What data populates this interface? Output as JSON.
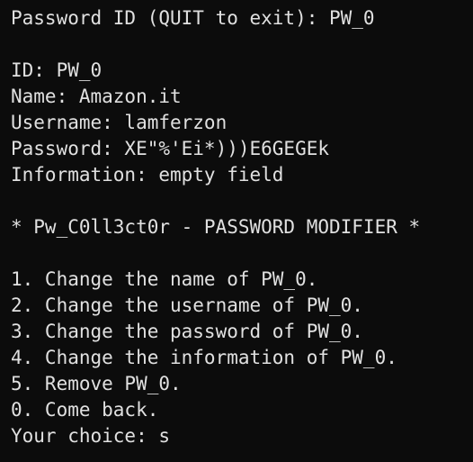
{
  "terminal": {
    "prompt_line": "Password ID (QUIT to exit): PW_0",
    "record": {
      "id_line": "ID: PW_0",
      "name_line": "Name: Amazon.it",
      "username_line": "Username: lamferzon",
      "password_line": "Password: XE\"%'Ei*)))E6GEGEk",
      "information_line": "Information: empty field"
    },
    "menu_title": "* Pw_C0ll3ct0r - PASSWORD MODIFIER *",
    "menu_items": [
      "1. Change the name of PW_0.",
      "2. Change the username of PW_0.",
      "3. Change the password of PW_0.",
      "4. Change the information of PW_0.",
      "5. Remove PW_0.",
      "0. Come back."
    ],
    "choice_line": "Your choice: s"
  },
  "colors": {
    "background": "#0c0c0c",
    "text": "#e0e0e0"
  }
}
